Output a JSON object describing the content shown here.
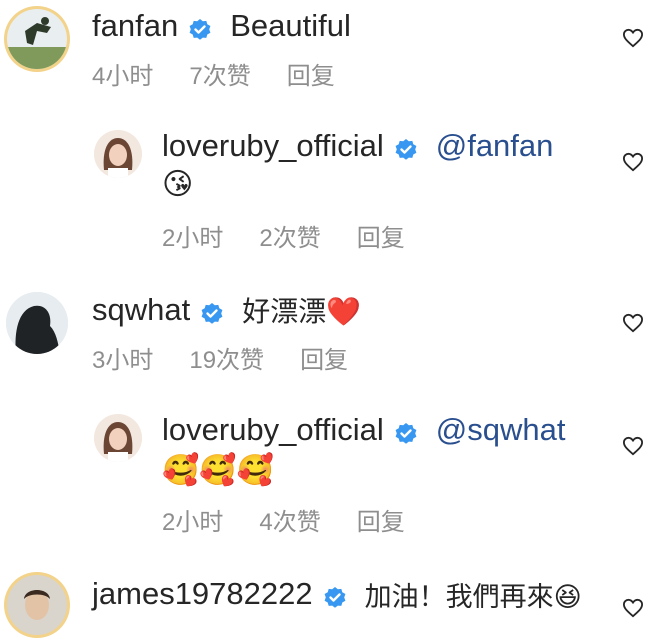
{
  "comments": [
    {
      "username": "fanfan",
      "text": "Beautiful",
      "time": "4小时",
      "likes": "7次赞",
      "reply": "回复",
      "avatar_icon": "person-leaping-photo"
    },
    {
      "username": "loveruby_official",
      "mention": "@fanfan",
      "emoji": "😘",
      "time": "2小时",
      "likes": "2次赞",
      "reply": "回复",
      "avatar_icon": "woman-portrait-photo"
    },
    {
      "username": "sqwhat",
      "text": "好漂漂❤️",
      "time": "3小时",
      "likes": "19次赞",
      "reply": "回复",
      "avatar_icon": "silhouette-profile-photo"
    },
    {
      "username": "loveruby_official",
      "mention": "@sqwhat",
      "emoji": "🥰🥰🥰",
      "time": "2小时",
      "likes": "4次赞",
      "reply": "回复",
      "avatar_icon": "woman-portrait-photo"
    },
    {
      "username": "james19782222",
      "text": "加油！我們再來😆",
      "avatar_icon": "man-portrait-photo"
    }
  ],
  "colors": {
    "verified": "#3897f0",
    "meta": "#8e8e8e",
    "mention": "#2a4f8f"
  }
}
